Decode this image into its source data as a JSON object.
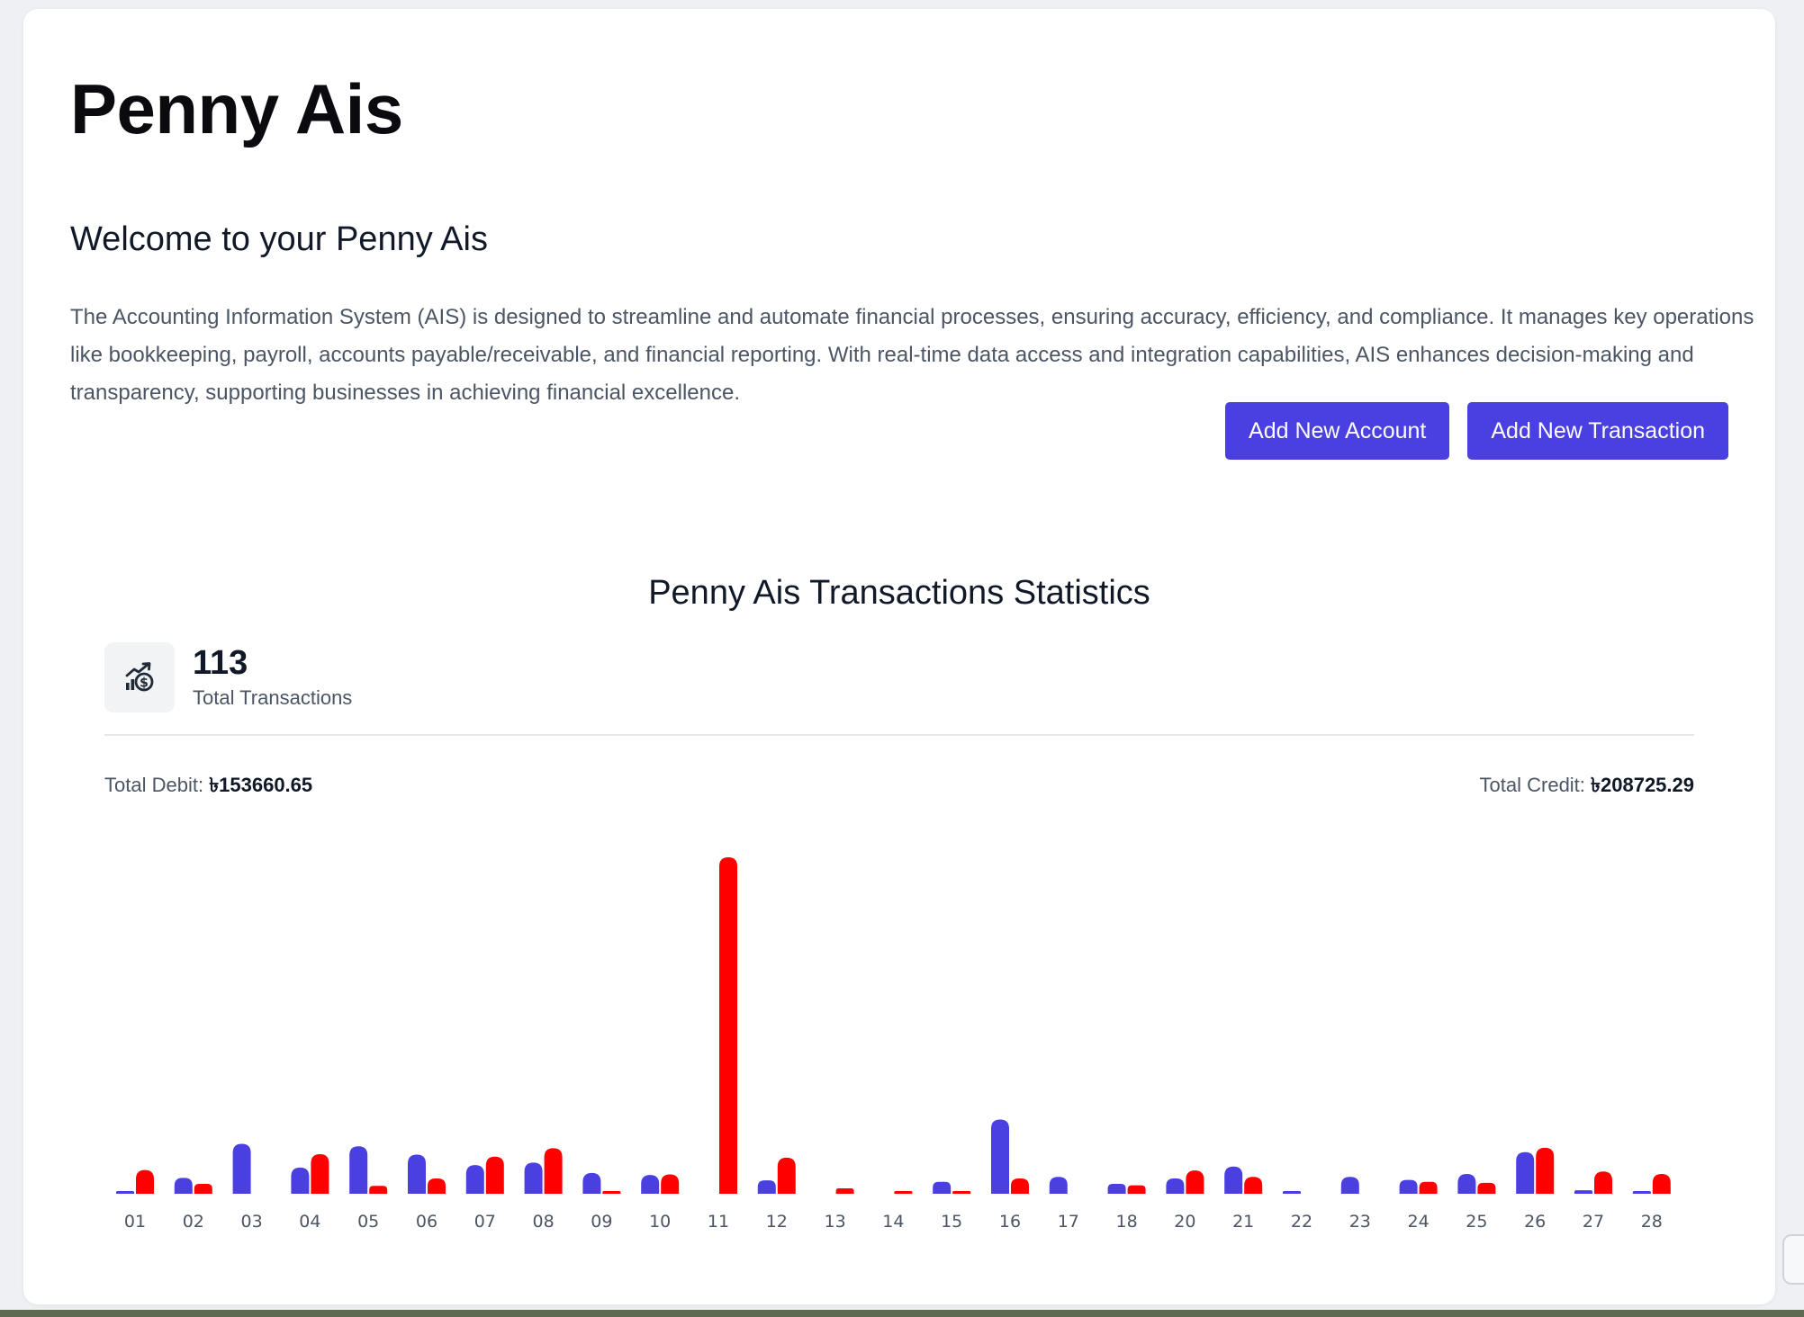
{
  "app": {
    "title": "Penny Ais",
    "welcome": "Welcome to your Penny Ais",
    "description": "The Accounting Information System (AIS) is designed to streamline and automate financial processes, ensuring accuracy, efficiency, and compliance. It manages key operations like bookkeeping, payroll, accounts payable/receivable, and financial reporting. With real-time data access and integration capabilities, AIS enhances decision-making and transparency, supporting businesses in achieving financial excellence."
  },
  "actions": {
    "add_account": "Add New Account",
    "add_transaction": "Add New Transaction"
  },
  "stats": {
    "title": "Penny Ais Transactions Statistics",
    "total_transactions": "113",
    "total_transactions_label": "Total Transactions",
    "debit_label": "Total Debit:",
    "debit_value": "৳153660.65",
    "credit_label": "Total Credit:",
    "credit_value": "৳208725.29",
    "icon": "money-growth-icon"
  },
  "colors": {
    "accent": "#4a3fe0",
    "debit": "#4a3fe0",
    "credit": "#ff0000"
  },
  "chart_data": {
    "type": "bar",
    "categories": [
      "01",
      "02",
      "03",
      "04",
      "05",
      "06",
      "07",
      "08",
      "09",
      "10",
      "11",
      "12",
      "13",
      "14",
      "15",
      "16",
      "17",
      "18",
      "20",
      "21",
      "22",
      "23",
      "24",
      "25",
      "26",
      "27",
      "28"
    ],
    "series": [
      {
        "values": [
          400,
          3200,
          10100,
          5300,
          9600,
          7900,
          5800,
          6300,
          4200,
          3800,
          0,
          2700,
          0,
          0,
          2400,
          15000,
          3400,
          2000,
          3100,
          5500,
          400,
          3400,
          2800,
          4000,
          8400,
          700,
          400
        ]
      },
      {
        "values": [
          4800,
          2000,
          0,
          8000,
          1600,
          3100,
          7500,
          9200,
          400,
          3900,
          68000,
          7300,
          1100,
          200,
          500,
          3100,
          0,
          1700,
          4700,
          3400,
          0,
          0,
          2400,
          2200,
          9300,
          4500,
          4000
        ]
      }
    ],
    "ylim": [
      0,
      70000
    ],
    "grid": false,
    "legend": "none"
  }
}
